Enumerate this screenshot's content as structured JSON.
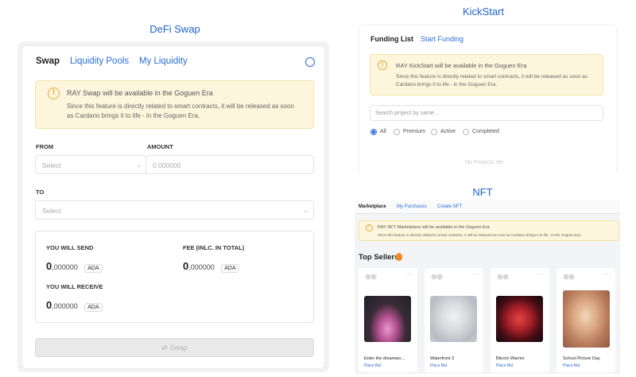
{
  "defi": {
    "title": "DeFi Swap",
    "tabs": [
      "Swap",
      "Liquidity Pools",
      "My Liquidity"
    ],
    "notice_title": "RAY Swap will be available in the Goguen Era",
    "notice_line1": "Since this feature is directly related to smart contracts, it will be released as soon",
    "notice_line2": "as Cardano brings it to life - in the Goguen Era.",
    "from_label": "FROM",
    "amount_label": "AMOUNT",
    "from_select": "Select",
    "amount_placeholder": "0.000000",
    "to_label": "TO",
    "to_select": "Select",
    "send_label": "YOU WILL SEND",
    "fee_label": "FEE (INLC. IN TOTAL)",
    "receive_label": "YOU WILL RECEIVE",
    "zero": "0",
    "decimals": ",000000",
    "currency": "ADA",
    "swap_button": "Swap"
  },
  "kickstart": {
    "title": "KickStart",
    "tabs": [
      "Funding List",
      "Start Funding"
    ],
    "notice_title": "RAY KickStart will be available in the Goguen Era",
    "notice_line1": "Since this feature is directly related to smart contracts, it will be released as soon as",
    "notice_line2": "Cardano brings it to life - in the Goguen Era.",
    "search_placeholder": "Search project by name...",
    "filters": [
      "All",
      "Premium",
      "Active",
      "Completed"
    ],
    "selected_filter": "All",
    "empty_text": "No Projects Yet"
  },
  "nft": {
    "title": "NFT",
    "tabs": [
      "Marketplace",
      "My Purchases",
      "Create NFT"
    ],
    "notice_title": "RAY NFT Marketplace will be available in the Goguen Era",
    "notice_text": "Since this feature is directly related to smart contracts, it will be released as soon as Cardano brings it to life - in the Goguen Era.",
    "top_sellers": "Top Sellers",
    "items": [
      {
        "name": "Enter the dreamwo...",
        "action": "Place Bid"
      },
      {
        "name": "Waterfront 3",
        "action": "Place Bid"
      },
      {
        "name": "Bitcoin Warrior",
        "action": "Place Bid"
      },
      {
        "name": "School Picture Day",
        "action": "Place Bid"
      }
    ]
  },
  "colors": {
    "accent": "#2a6fd6",
    "title_blue": "#1f63c9",
    "warning_bg": "#fdf6dc",
    "warning_icon": "#e0a83a"
  }
}
